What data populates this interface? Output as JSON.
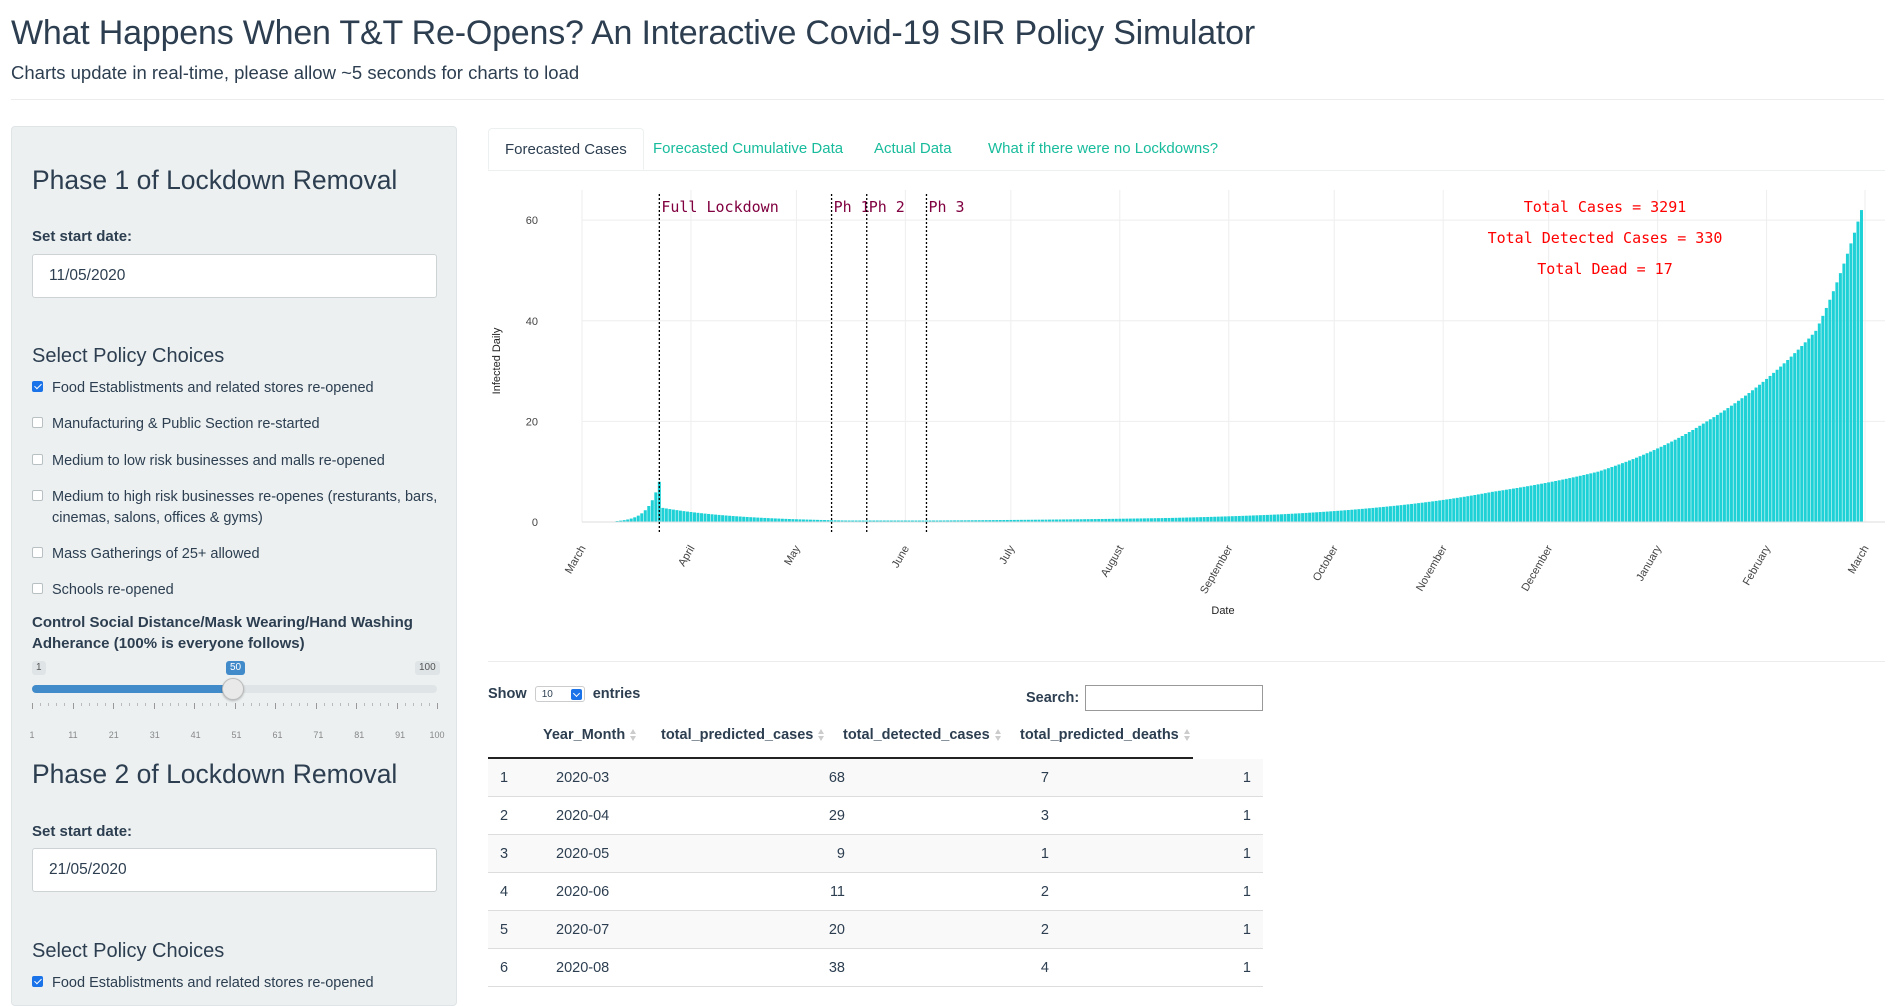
{
  "page": {
    "title": "What Happens When T&T Re-Opens? An Interactive Covid-19 SIR Policy Simulator",
    "subtitle": "Charts update in real-time, please allow ~5 seconds for charts to load"
  },
  "sidebar": {
    "phase1": {
      "heading": "Phase 1 of Lockdown Removal",
      "start_label": "Set start date:",
      "start_value": "11/05/2020",
      "policy_heading": "Select Policy Choices",
      "policies": [
        {
          "label": "Food Establistments and related stores re-opened",
          "checked": true
        },
        {
          "label": "Manufacturing & Public Section re-started",
          "checked": false
        },
        {
          "label": "Medium to low risk businesses and malls re-opened",
          "checked": false
        },
        {
          "label": "Medium to high risk businesses re-openes (resturants, bars, cinemas, salons, offices & gyms)",
          "checked": false
        },
        {
          "label": "Mass Gatherings of 25+ allowed",
          "checked": false
        },
        {
          "label": "Schools re-opened",
          "checked": false
        }
      ],
      "slider": {
        "label": "Control Social Distance/Mask Wearing/Hand Washing Adherance (100% is everyone follows)",
        "min": "1",
        "max": "100",
        "value": "50",
        "tick_labels": [
          "1",
          "11",
          "21",
          "31",
          "41",
          "51",
          "61",
          "71",
          "81",
          "91",
          "100"
        ]
      }
    },
    "phase2": {
      "heading": "Phase 2 of Lockdown Removal",
      "start_label": "Set start date:",
      "start_value": "21/05/2020",
      "policy_heading": "Select Policy Choices",
      "policies": [
        {
          "label": "Food Establistments and related stores re-opened",
          "checked": true
        }
      ]
    }
  },
  "tabs": [
    {
      "label": "Forecasted Cases",
      "active": true
    },
    {
      "label": "Forecasted Cumulative Data",
      "active": false
    },
    {
      "label": "Actual Data",
      "active": false
    },
    {
      "label": "What if there were no Lockdowns?",
      "active": false
    }
  ],
  "chart_data": {
    "type": "bar",
    "xlabel": "Date",
    "ylabel": "Infected Daily",
    "ylim": [
      0,
      64
    ],
    "yticks": [
      0,
      20,
      40,
      60
    ],
    "x_tick_labels": [
      "March",
      "April",
      "May",
      "June",
      "July",
      "August",
      "September",
      "October",
      "November",
      "December",
      "January",
      "February",
      "March"
    ],
    "x_start": "2020-03-01",
    "x_end": "2021-03-01",
    "first_bar": "2020-03-11",
    "last_bar": "2021-02-28",
    "series_color": "#1dd1d6",
    "vlines": [
      {
        "date": "2020-03-23",
        "label": "Full Lockdown"
      },
      {
        "date": "2020-05-11",
        "label": "Ph 1"
      },
      {
        "date": "2020-05-21",
        "label": "Ph 2"
      },
      {
        "date": "2020-06-07",
        "label": "Ph 3"
      }
    ],
    "annotations": [
      "Total Cases = 3291",
      "Total Detected Cases = 330",
      "Total Dead = 17"
    ],
    "annotation_color": "#ff0000",
    "vline_label_color": "#800040",
    "key_points": [
      {
        "date": "2020-03-11",
        "value": 0.2
      },
      {
        "date": "2020-03-23",
        "value": 8
      },
      {
        "date": "2020-03-24",
        "value": 2.8
      },
      {
        "date": "2020-05-15",
        "value": 0.3
      },
      {
        "date": "2020-06-10",
        "value": 0.3
      },
      {
        "date": "2020-07-15",
        "value": 0.5
      },
      {
        "date": "2020-08-15",
        "value": 0.8
      },
      {
        "date": "2020-09-15",
        "value": 1.5
      },
      {
        "date": "2020-10-15",
        "value": 3
      },
      {
        "date": "2020-11-15",
        "value": 6
      },
      {
        "date": "2020-12-15",
        "value": 10
      },
      {
        "date": "2021-01-15",
        "value": 20
      },
      {
        "date": "2021-02-15",
        "value": 38
      },
      {
        "date": "2021-02-28",
        "value": 62
      }
    ]
  },
  "table": {
    "show_label": "Show",
    "entries_value": "10",
    "entries_label": "entries",
    "search_label": "Search:",
    "columns": [
      "Year_Month",
      "total_predicted_cases",
      "total_detected_cases",
      "total_predicted_deaths"
    ],
    "rows": [
      [
        "1",
        "2020-03",
        "68",
        "7",
        "1"
      ],
      [
        "2",
        "2020-04",
        "29",
        "3",
        "1"
      ],
      [
        "3",
        "2020-05",
        "9",
        "1",
        "1"
      ],
      [
        "4",
        "2020-06",
        "11",
        "2",
        "1"
      ],
      [
        "5",
        "2020-07",
        "20",
        "2",
        "1"
      ],
      [
        "6",
        "2020-08",
        "38",
        "4",
        "1"
      ]
    ]
  }
}
